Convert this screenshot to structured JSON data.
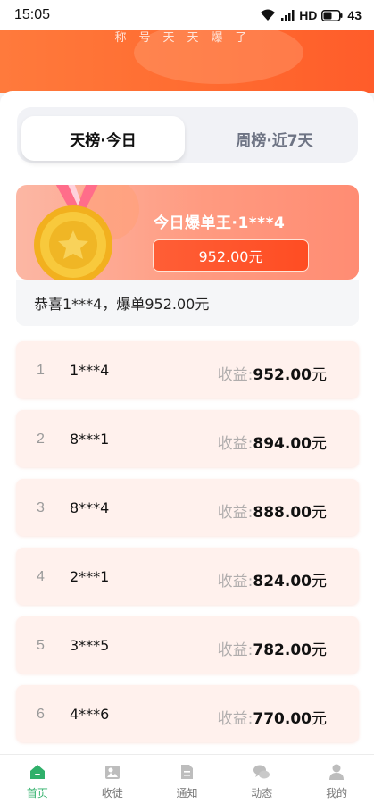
{
  "status_bar": {
    "time": "15:05",
    "network": "HD",
    "battery": "43"
  },
  "header": {
    "subtitle": "称号天天爆了"
  },
  "tabs": [
    {
      "label": "天榜·今日",
      "active": true
    },
    {
      "label": "周榜·近7天",
      "active": false
    }
  ],
  "champion": {
    "title": "今日爆单王·1***4",
    "amount": "952.00元"
  },
  "congrats": "恭喜1***4，爆单952.00元",
  "ranking": {
    "income_label": "收益:",
    "unit": "元",
    "rows": [
      {
        "rank": "1",
        "user": "1***4",
        "value": "952.00"
      },
      {
        "rank": "2",
        "user": "8***1",
        "value": "894.00"
      },
      {
        "rank": "3",
        "user": "8***4",
        "value": "888.00"
      },
      {
        "rank": "4",
        "user": "2***1",
        "value": "824.00"
      },
      {
        "rank": "5",
        "user": "3***5",
        "value": "782.00"
      },
      {
        "rank": "6",
        "user": "4***6",
        "value": "770.00"
      }
    ]
  },
  "bottom_nav": [
    {
      "label": "首页",
      "icon": "home-icon",
      "active": true
    },
    {
      "label": "收徒",
      "icon": "apprentice-icon",
      "active": false
    },
    {
      "label": "通知",
      "icon": "notice-icon",
      "active": false
    },
    {
      "label": "动态",
      "icon": "chat-icon",
      "active": false
    },
    {
      "label": "我的",
      "icon": "profile-icon",
      "active": false
    }
  ],
  "colors": {
    "accent": "#ff5c2a",
    "nav_active": "#2fb06a",
    "row_bg": "#fff1ed"
  }
}
